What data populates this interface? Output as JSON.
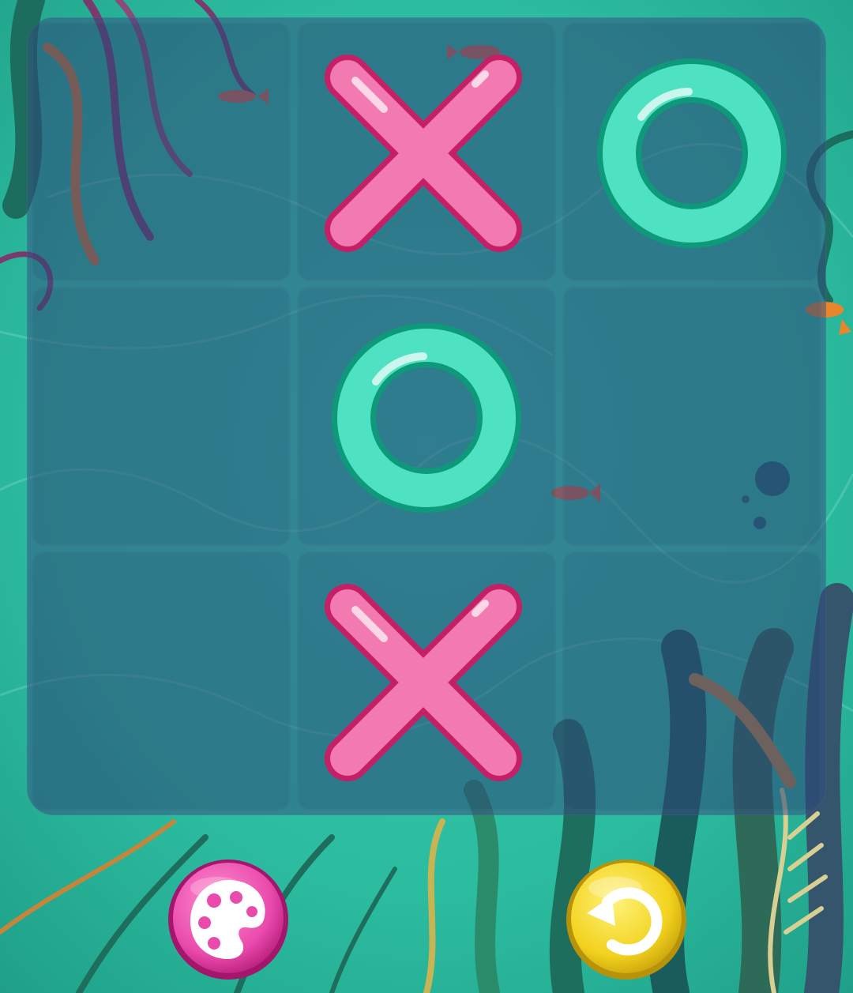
{
  "game": {
    "board": [
      [
        "",
        "X",
        "O"
      ],
      [
        "",
        "O",
        ""
      ],
      [
        "",
        "X",
        ""
      ]
    ]
  },
  "controls": {
    "left_button_icon": "palette-icon",
    "right_button_icon": "undo-icon"
  },
  "colors": {
    "x_mark": "#f27ab0",
    "x_outline": "#c51f66",
    "o_mark": "#4fe2c2",
    "o_outline": "#0e9a7a",
    "palette_button": "#e94aac",
    "undo_button": "#f2d21e",
    "board_overlay": "#344e80",
    "background": "#29bfa3"
  }
}
